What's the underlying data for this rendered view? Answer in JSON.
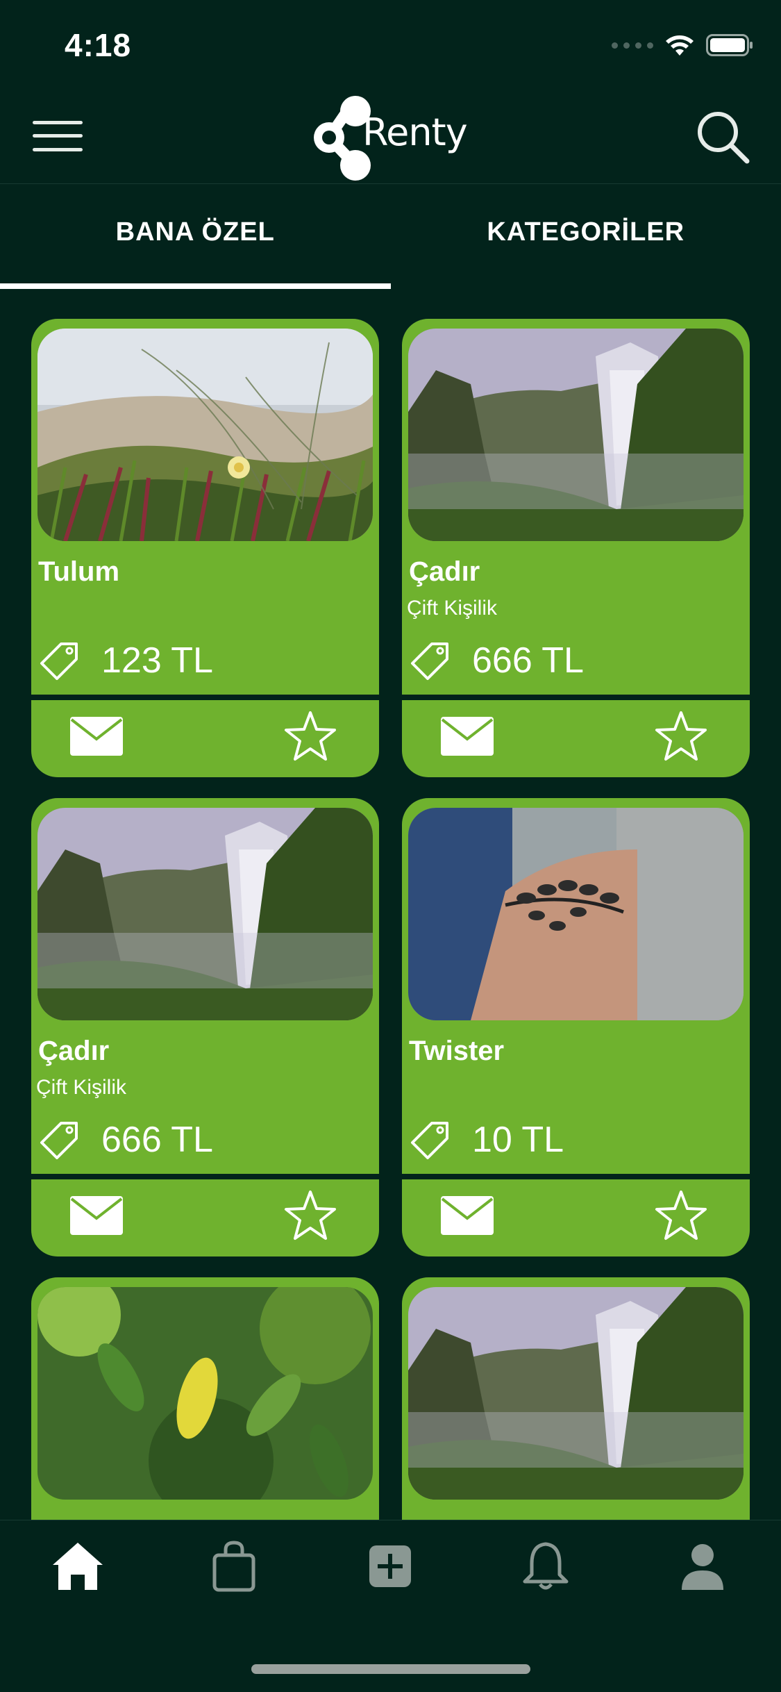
{
  "status": {
    "time": "4:18"
  },
  "header": {
    "logo_text": "Renty",
    "menu_icon": "hamburger-menu-icon",
    "search_icon": "search-icon"
  },
  "tabs": [
    {
      "label": "BANA ÖZEL",
      "active": true
    },
    {
      "label": "KATEGORİLER",
      "active": false
    }
  ],
  "cards": [
    {
      "title": "Tulum",
      "subtitle": "",
      "price": "123 TL",
      "image": "beach-plants"
    },
    {
      "title": "Çadır",
      "subtitle": "Çift Kişilik",
      "price": "666 TL",
      "image": "waterfall"
    },
    {
      "title": "Çadır",
      "subtitle": "Çift Kişilik",
      "price": "666 TL",
      "image": "waterfall"
    },
    {
      "title": "Twister",
      "subtitle": "",
      "price": "10 TL",
      "image": "wrist-tattoo"
    },
    {
      "title": "",
      "subtitle": "",
      "price": "",
      "image": "green-leaves"
    },
    {
      "title": "",
      "subtitle": "",
      "price": "",
      "image": "waterfall"
    }
  ],
  "tab_bar": [
    {
      "icon": "home-icon",
      "active": true
    },
    {
      "icon": "shopping-bag-icon",
      "active": false
    },
    {
      "icon": "add-square-icon",
      "active": false
    },
    {
      "icon": "bell-icon",
      "active": false
    },
    {
      "icon": "user-icon",
      "active": false
    }
  ],
  "colors": {
    "background": "#02231b",
    "card": "#6fb22e",
    "inactive_icon": "#8a9893"
  }
}
